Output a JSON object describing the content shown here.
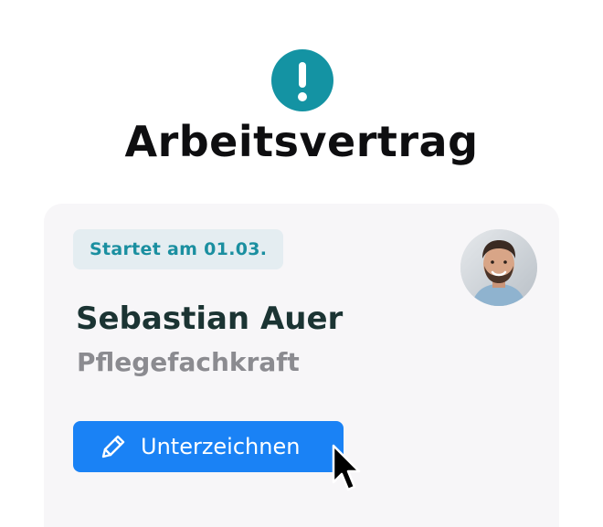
{
  "header": {
    "alert_icon": "exclamation-icon",
    "title": "Arbeitsvertrag",
    "accent_color": "#1493a3"
  },
  "card": {
    "start_badge": "Startet am 01.03.",
    "avatar_icon": "person-avatar",
    "name": "Sebastian Auer",
    "role": "Pflegefachkraft",
    "sign_button": {
      "icon": "pencil-icon",
      "label": "Unterzeichnen",
      "color": "#1a82f5"
    }
  },
  "cursor_icon": "mouse-pointer-icon"
}
